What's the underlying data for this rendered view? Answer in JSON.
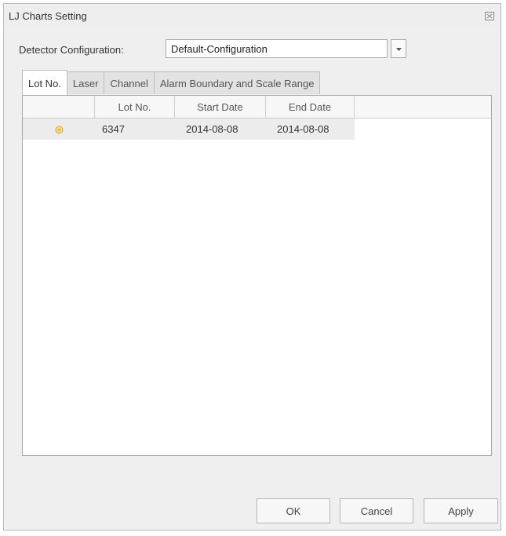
{
  "window": {
    "title": "LJ Charts Setting"
  },
  "detector_config": {
    "label": "Detector Configuration:",
    "selected": "Default-Configuration"
  },
  "tabs": [
    {
      "label": "Lot No.",
      "active": true
    },
    {
      "label": "Laser",
      "active": false
    },
    {
      "label": "Channel",
      "active": false
    },
    {
      "label": "Alarm Boundary and Scale Range",
      "active": false
    }
  ],
  "table": {
    "columns": [
      "",
      "Lot No.",
      "Start Date",
      "End Date"
    ],
    "rows": [
      {
        "status_icon": "yellow-dot-icon",
        "lot_no": "6347",
        "start_date": "2014-08-08",
        "end_date": "2014-08-08"
      }
    ]
  },
  "buttons": {
    "ok": "OK",
    "cancel": "Cancel",
    "apply": "Apply"
  },
  "colors": {
    "status_dot": "#e8c34a",
    "selected_row": "#ececec"
  }
}
